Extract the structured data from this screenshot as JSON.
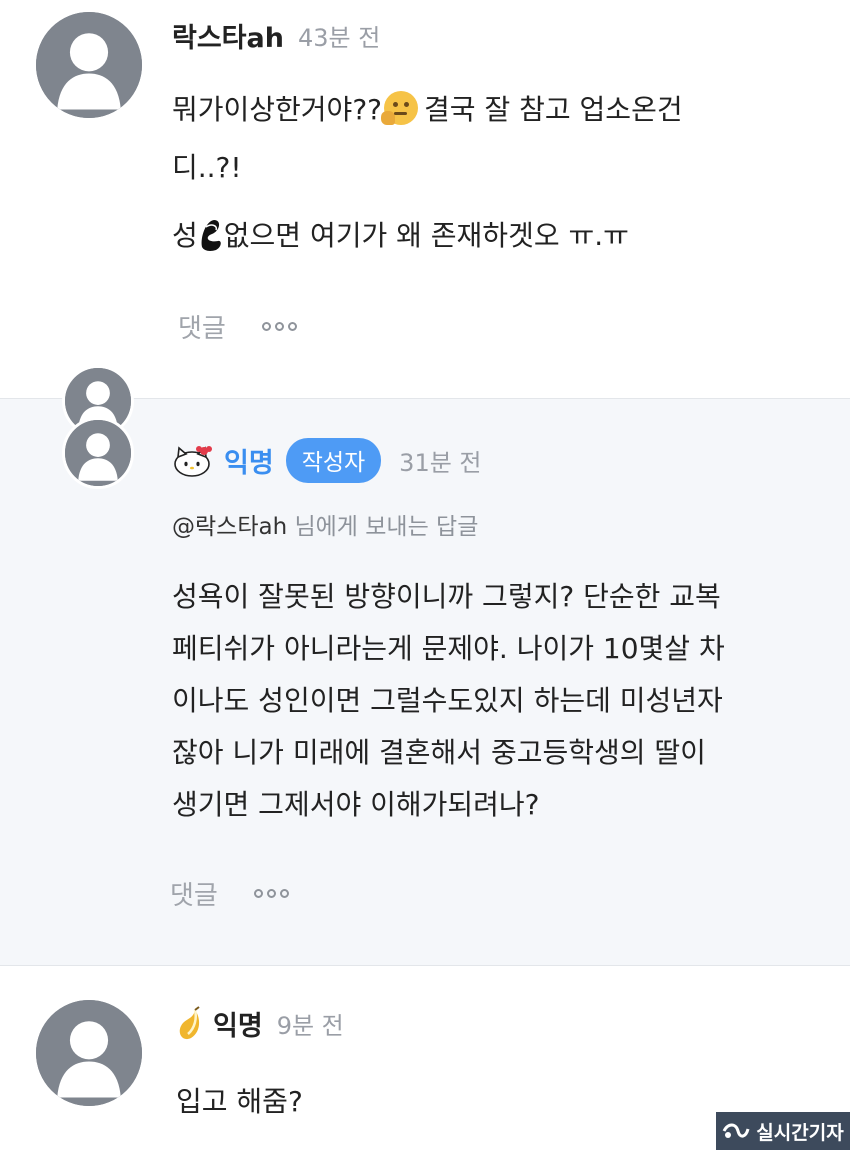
{
  "comments": [
    {
      "nickname": "락스타ah",
      "time": "43분 전",
      "line1_before": "뭐가이상한거야??",
      "line1_after": "결국 잘 참고 업소온건",
      "line2": "디..?!",
      "line3_before": "성",
      "line3_after": "없으면 여기가 왜 존재하겟오 ㅠ.ㅠ",
      "reply_label": "댓글"
    },
    {
      "nickname": "익명",
      "badge": "작성자",
      "time": "31분 전",
      "reply_to_user": "@락스타ah",
      "reply_to_suffix": "님에게 보내는 답글",
      "lines": [
        "성욕이 잘못된 방향이니까 그렇지? 단순한 교복",
        "페티쉬가 아니라는게 문제야. 나이가 10몇살 차",
        "이나도 성인이면 그럴수도있지 하는데 미성년자",
        "잖아 니가 미래에 결혼해서 중고등학생의 딸이",
        "생기면 그제서야 이해가되려나?"
      ],
      "reply_label": "댓글"
    },
    {
      "nickname": "익명",
      "time": "9분 전",
      "text": "입고 해줌?"
    }
  ],
  "watermark": "실시간기자",
  "icons": {
    "avatar": "default-user-avatar-icon",
    "thinking": "thinking-face-emoji",
    "kitty": "hello-kitty-icon",
    "lemon": "lemon-icon",
    "more": "more-dots-icon"
  },
  "colors": {
    "badge": "#4e9bf5",
    "highlight_bg": "#f5f7fa",
    "muted_text": "#9a9ea6"
  }
}
